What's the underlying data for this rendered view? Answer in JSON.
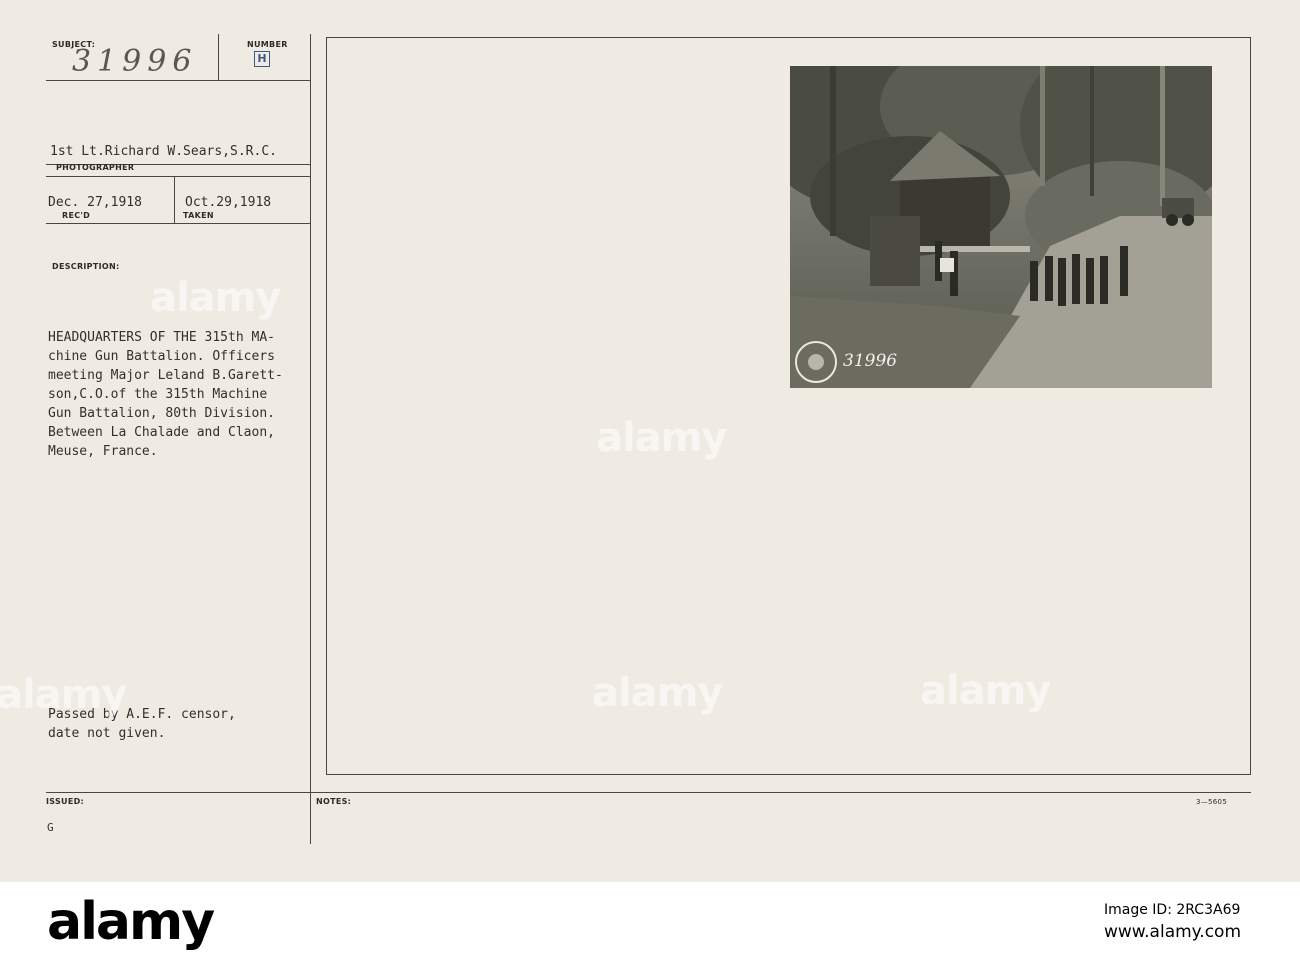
{
  "card": {
    "labels": {
      "subject": "SUBJECT:",
      "number": "NUMBER",
      "photographer": "PHOTOGRAPHER",
      "recd": "REC'D",
      "taken": "TAKEN",
      "description": "DESCRIPTION:",
      "issued": "ISSUED:",
      "notes": "NOTES:"
    },
    "subject_number": "31996",
    "number_letter": "H",
    "photographer_name": "1st Lt.Richard W.Sears,S.R.C.",
    "date_received": "Dec. 27,1918",
    "date_taken": "Oct.29,1918",
    "description_lines": [
      "HEADQUARTERS OF THE 315th MA-",
      "chine Gun Battalion. Officers",
      "meeting Major Leland B.Garett-",
      "son,C.O.of the 315th Machine",
      "Gun Battalion, 80th Division.",
      "Between La Chalade and Claon,",
      "Meuse, France."
    ],
    "censor_lines": [
      "Passed by A.E.F. censor,",
      "date not given."
    ],
    "issued_mark": "G",
    "form_number": "3—5605",
    "photo_number": "31996"
  },
  "watermark": {
    "text": "alamy"
  },
  "banner": {
    "logo": "alamy",
    "image_id": "Image ID: 2RC3A69",
    "url": "www.alamy.com"
  }
}
